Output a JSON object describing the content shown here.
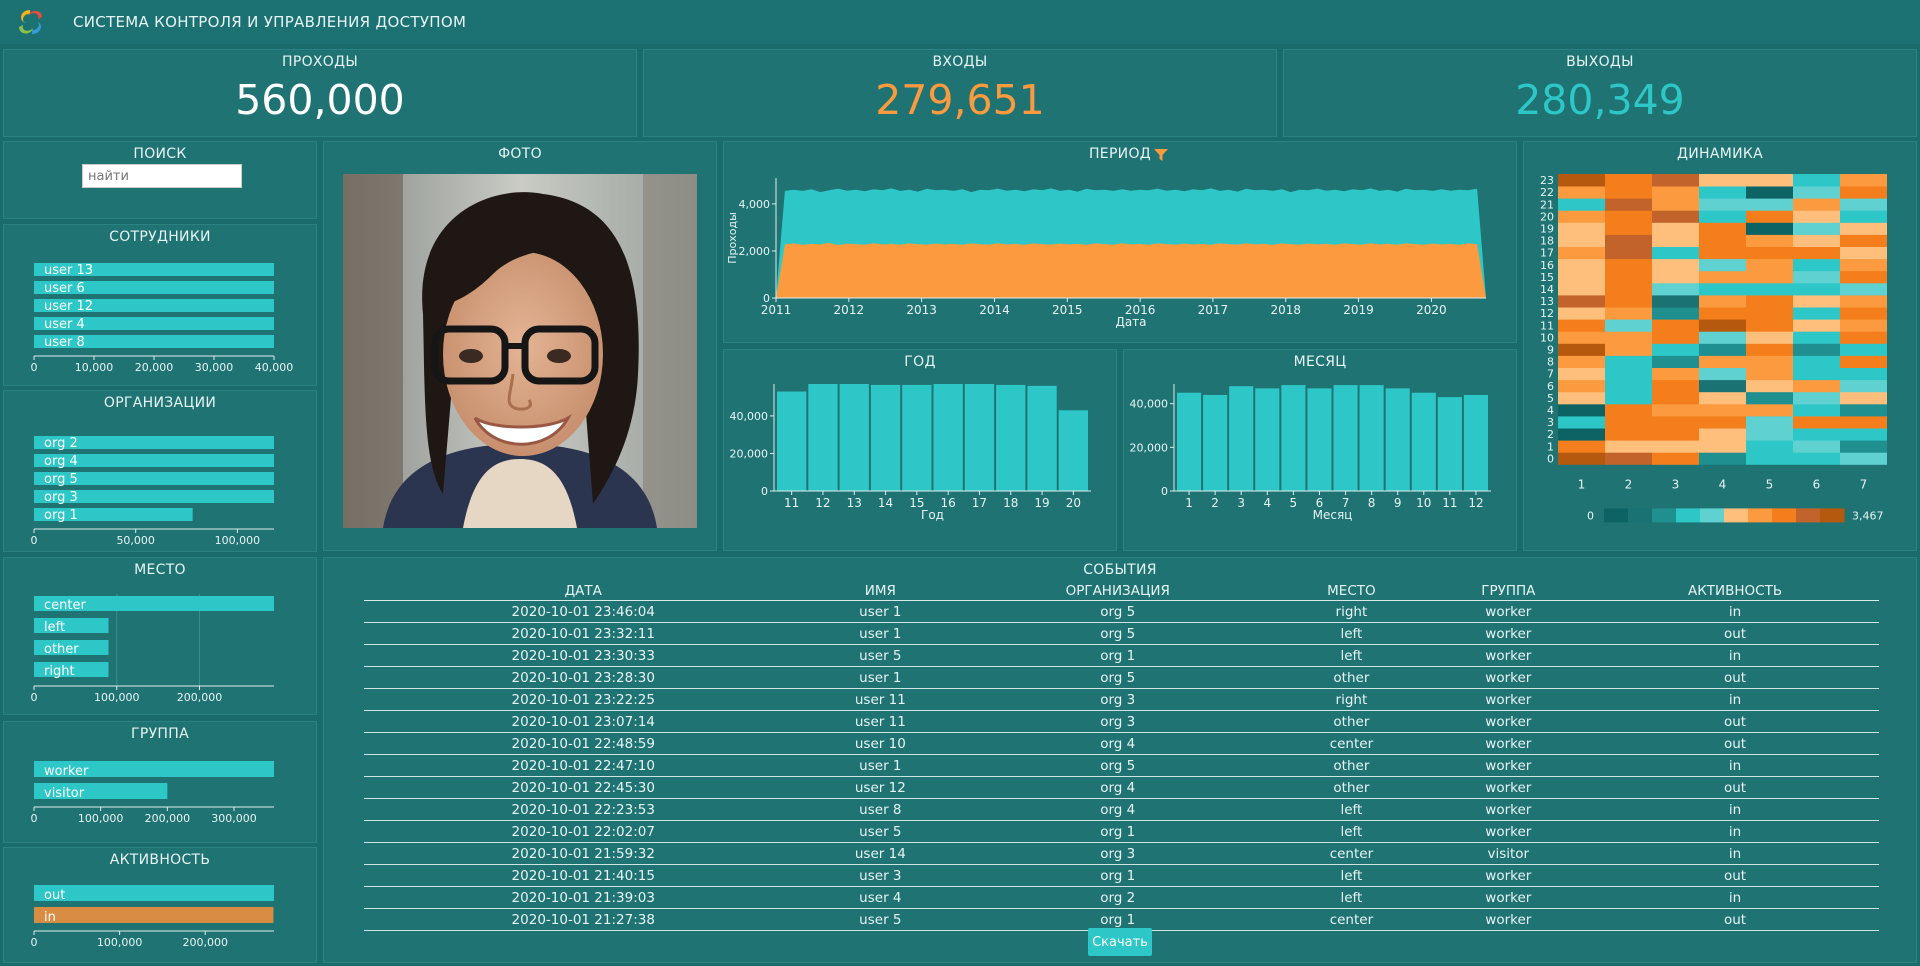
{
  "app": {
    "title": "СИСТЕМА КОНТРОЛЯ И УПРАВЛЕНИЯ ДОСТУПОМ"
  },
  "colors": {
    "background": "#1a6b6b",
    "panel": "#1f7373",
    "teal": "#2ec7c7",
    "orange": "#fb9a3e",
    "activity_in": "#d88d42",
    "text": "#e8f4f4"
  },
  "kpis": [
    {
      "title": "ПРОХОДЫ",
      "value": "560,000",
      "color": "#ffffff"
    },
    {
      "title": "ВХОДЫ",
      "value": "279,651",
      "color": "#fb9a3e"
    },
    {
      "title": "ВЫХОДЫ",
      "value": "280,349",
      "color": "#2ec7c7"
    }
  ],
  "search": {
    "title": "ПОИСК",
    "placeholder": "найти"
  },
  "photo": {
    "title": "ФОТО"
  },
  "events": {
    "title": "СОБЫТИЯ",
    "columns": [
      "ДАТА",
      "ИМЯ",
      "ОРГАНИЗАЦИЯ",
      "МЕСТО",
      "ГРУППА",
      "АКТИВНОСТЬ"
    ],
    "rows": [
      [
        "2020-10-01 23:46:04",
        "user 1",
        "org 5",
        "right",
        "worker",
        "in"
      ],
      [
        "2020-10-01 23:32:11",
        "user 1",
        "org 5",
        "left",
        "worker",
        "out"
      ],
      [
        "2020-10-01 23:30:33",
        "user 5",
        "org 1",
        "left",
        "worker",
        "in"
      ],
      [
        "2020-10-01 23:28:30",
        "user 1",
        "org 5",
        "other",
        "worker",
        "out"
      ],
      [
        "2020-10-01 23:22:25",
        "user 11",
        "org 3",
        "right",
        "worker",
        "in"
      ],
      [
        "2020-10-01 23:07:14",
        "user 11",
        "org 3",
        "other",
        "worker",
        "out"
      ],
      [
        "2020-10-01 22:48:59",
        "user 10",
        "org 4",
        "center",
        "worker",
        "out"
      ],
      [
        "2020-10-01 22:47:10",
        "user 1",
        "org 5",
        "other",
        "worker",
        "in"
      ],
      [
        "2020-10-01 22:45:30",
        "user 12",
        "org 4",
        "other",
        "worker",
        "out"
      ],
      [
        "2020-10-01 22:23:53",
        "user 8",
        "org 4",
        "left",
        "worker",
        "in"
      ],
      [
        "2020-10-01 22:02:07",
        "user 5",
        "org 1",
        "left",
        "worker",
        "in"
      ],
      [
        "2020-10-01 21:59:32",
        "user 14",
        "org 3",
        "center",
        "visitor",
        "in"
      ],
      [
        "2020-10-01 21:40:15",
        "user 3",
        "org 1",
        "left",
        "worker",
        "out"
      ],
      [
        "2020-10-01 21:39:03",
        "user 4",
        "org 2",
        "left",
        "worker",
        "in"
      ],
      [
        "2020-10-01 21:27:38",
        "user 5",
        "org 1",
        "center",
        "worker",
        "out"
      ]
    ],
    "download_label": "Скачать"
  },
  "chart_data": [
    {
      "id": "employees",
      "type": "bar",
      "orientation": "horizontal",
      "title": "СОТРУДНИКИ",
      "categories": [
        "user 13",
        "user 6",
        "user 12",
        "user 4",
        "user 8"
      ],
      "values": [
        40000,
        40000,
        40000,
        40000,
        40000
      ],
      "xlim": [
        0,
        40000
      ],
      "xticks": [
        0,
        10000,
        20000,
        30000,
        40000
      ],
      "xtick_labels": [
        "0",
        "10,000",
        "20,000",
        "30,000",
        "40,000"
      ]
    },
    {
      "id": "orgs",
      "type": "bar",
      "orientation": "horizontal",
      "title": "ОРГАНИЗАЦИИ",
      "categories": [
        "org 2",
        "org 4",
        "org 5",
        "org 3",
        "org 1"
      ],
      "values": [
        118000,
        118000,
        118000,
        118000,
        78000
      ],
      "xlim": [
        0,
        118000
      ],
      "xticks": [
        0,
        50000,
        100000
      ],
      "xtick_labels": [
        "0",
        "50,000",
        "100,000"
      ]
    },
    {
      "id": "places",
      "type": "bar",
      "orientation": "horizontal",
      "title": "МЕСТО",
      "categories": [
        "center",
        "left",
        "other",
        "right"
      ],
      "values": [
        290000,
        90000,
        90000,
        90000
      ],
      "xlim": [
        0,
        290000
      ],
      "xticks": [
        0,
        100000,
        200000
      ],
      "xtick_labels": [
        "0",
        "100,000",
        "200,000"
      ],
      "grid": true
    },
    {
      "id": "groups",
      "type": "bar",
      "orientation": "horizontal",
      "title": "ГРУППА",
      "categories": [
        "worker",
        "visitor"
      ],
      "values": [
        360000,
        200000
      ],
      "xlim": [
        0,
        360000
      ],
      "xticks": [
        0,
        100000,
        200000,
        300000
      ],
      "xtick_labels": [
        "0",
        "100,000",
        "200,000",
        "300,000"
      ]
    },
    {
      "id": "activity",
      "type": "bar",
      "orientation": "horizontal",
      "title": "АКТИВНОСТЬ",
      "categories": [
        "out",
        "in"
      ],
      "values": [
        280349,
        279651
      ],
      "colors": [
        "#2ec7c7",
        "#d88d42"
      ],
      "xlim": [
        0,
        280349
      ],
      "xticks": [
        0,
        100000,
        200000
      ],
      "xtick_labels": [
        "0",
        "100,000",
        "200,000"
      ]
    },
    {
      "id": "period",
      "type": "area",
      "title": "ПЕРИОД",
      "xlabel": "Дата",
      "ylabel": "Проходы",
      "xlim": [
        2011,
        2020.75
      ],
      "xtick_values": [
        2011,
        2012,
        2013,
        2014,
        2015,
        2016,
        2017,
        2018,
        2019,
        2020
      ],
      "xtick_labels": [
        "2011",
        "2012",
        "2013",
        "2014",
        "2015",
        "2016",
        "2017",
        "2018",
        "2019",
        "2020"
      ],
      "ylim": [
        0,
        5100
      ],
      "yticks": [
        0,
        2000,
        4000
      ],
      "ytick_labels": [
        "0",
        "2,000",
        "4,000"
      ],
      "series": [
        {
          "color": "#2ec7c7",
          "values": [
            0,
            4550,
            4600,
            4550,
            4620,
            4500,
            4580,
            4650,
            4560,
            4600,
            4540,
            4620,
            4580,
            4660,
            4550,
            4600,
            4520,
            4640,
            4580,
            4600,
            4550,
            4620,
            4500,
            4600,
            4580,
            4650,
            4560,
            4600,
            4540,
            4620,
            4580,
            4660,
            4550,
            4600,
            4520,
            4640,
            4580,
            4600,
            4550,
            4620,
            4560,
            4600,
            4580,
            4650,
            4560,
            4600,
            4540,
            4620,
            4580,
            4660,
            4550,
            4600,
            4520,
            4640,
            4580,
            4600,
            4550,
            4620,
            4500,
            4600,
            4580,
            4650,
            4560,
            4600,
            4540,
            4620,
            4580,
            4660,
            4550,
            4600,
            4520,
            4640,
            4580,
            4600,
            4550,
            4620,
            4560,
            4600,
            4580,
            4650,
            0
          ]
        },
        {
          "color": "#fb9a3e",
          "values": [
            0,
            2280,
            2320,
            2260,
            2300,
            2280,
            2340,
            2250,
            2310,
            2290,
            2270,
            2330,
            2280,
            2300,
            2260,
            2320,
            2290,
            2270,
            2310,
            2280,
            2300,
            2260,
            2320,
            2290,
            2270,
            2330,
            2280,
            2300,
            2260,
            2320,
            2290,
            2270,
            2310,
            2280,
            2300,
            2260,
            2320,
            2290,
            2270,
            2330,
            2280,
            2300,
            2260,
            2320,
            2290,
            2270,
            2310,
            2280,
            2300,
            2260,
            2320,
            2290,
            2270,
            2330,
            2280,
            2300,
            2260,
            2320,
            2290,
            2270,
            2310,
            2280,
            2300,
            2260,
            2320,
            2290,
            2270,
            2330,
            2280,
            2300,
            2260,
            2320,
            2290,
            2270,
            2310,
            2280,
            2300,
            2260,
            2320,
            2290,
            0
          ]
        }
      ]
    },
    {
      "id": "year",
      "type": "bar",
      "title": "ГОД",
      "xlabel": "Год",
      "categories": [
        "11",
        "12",
        "13",
        "14",
        "15",
        "16",
        "17",
        "18",
        "19",
        "20"
      ],
      "values": [
        53000,
        57000,
        57000,
        56500,
        56500,
        57000,
        57000,
        56500,
        56000,
        43000
      ],
      "ylim": [
        0,
        57000
      ],
      "yticks": [
        0,
        20000,
        40000
      ],
      "ytick_labels": [
        "0",
        "20,000",
        "40,000"
      ]
    },
    {
      "id": "month",
      "type": "bar",
      "title": "МЕСЯЦ",
      "xlabel": "Месяц",
      "categories": [
        "1",
        "2",
        "3",
        "4",
        "5",
        "6",
        "7",
        "8",
        "9",
        "10",
        "11",
        "12"
      ],
      "values": [
        45000,
        44000,
        48000,
        47000,
        48500,
        47000,
        48500,
        48500,
        47000,
        45000,
        43000,
        44000
      ],
      "ylim": [
        0,
        49000
      ],
      "yticks": [
        0,
        20000,
        40000
      ],
      "ytick_labels": [
        "0",
        "20,000",
        "40,000"
      ]
    },
    {
      "id": "dynamics",
      "type": "heatmap",
      "title": "ДИНАМИКА",
      "x_labels": [
        "1",
        "2",
        "3",
        "4",
        "5",
        "6",
        "7"
      ],
      "y_labels": [
        "0",
        "1",
        "2",
        "3",
        "4",
        "5",
        "6",
        "7",
        "8",
        "9",
        "10",
        "11",
        "12",
        "13",
        "14",
        "15",
        "16",
        "17",
        "18",
        "19",
        "20",
        "21",
        "22",
        "23"
      ],
      "colorbar": {
        "min_label": "0",
        "max_label": "3,467",
        "min": 0,
        "max": 3467,
        "colors": [
          "#0d6363",
          "#1a7272",
          "#1f8f8f",
          "#2ec7c7",
          "#5fd1d1",
          "#fdbf7b",
          "#fb9a3e",
          "#f57e1c",
          "#c1632b",
          "#b4590e"
        ]
      },
      "values": [
        [
          9,
          8,
          7,
          2,
          3,
          3,
          4
        ],
        [
          7,
          5,
          5,
          5,
          3,
          4,
          2
        ],
        [
          0,
          7,
          7,
          5,
          4,
          3,
          3
        ],
        [
          3,
          7,
          7,
          7,
          4,
          7,
          7
        ],
        [
          0,
          7,
          6,
          6,
          6,
          3,
          2
        ],
        [
          5,
          3,
          7,
          5,
          2,
          4,
          5
        ],
        [
          6,
          3,
          7,
          1,
          5,
          6,
          4
        ],
        [
          5,
          3,
          6,
          4,
          6,
          3,
          3
        ],
        [
          6,
          3,
          2,
          6,
          6,
          3,
          7
        ],
        [
          9,
          6,
          3,
          2,
          7,
          2,
          3
        ],
        [
          6,
          6,
          7,
          4,
          5,
          3,
          7
        ],
        [
          7,
          4,
          7,
          9,
          7,
          5,
          6
        ],
        [
          5,
          6,
          2,
          7,
          7,
          3,
          7
        ],
        [
          8,
          7,
          1,
          6,
          7,
          5,
          6
        ],
        [
          5,
          7,
          4,
          3,
          3,
          3,
          4
        ],
        [
          5,
          7,
          5,
          6,
          6,
          4,
          7
        ],
        [
          5,
          7,
          5,
          4,
          6,
          3,
          6
        ],
        [
          6,
          8,
          3,
          7,
          7,
          7,
          5
        ],
        [
          5,
          8,
          5,
          7,
          6,
          5,
          7
        ],
        [
          5,
          7,
          5,
          7,
          0,
          4,
          5
        ],
        [
          6,
          7,
          8,
          3,
          7,
          5,
          3
        ],
        [
          3,
          8,
          6,
          4,
          4,
          6,
          4
        ],
        [
          6,
          7,
          6,
          3,
          0,
          4,
          7
        ],
        [
          9,
          7,
          8,
          5,
          5,
          3,
          6
        ]
      ]
    }
  ]
}
